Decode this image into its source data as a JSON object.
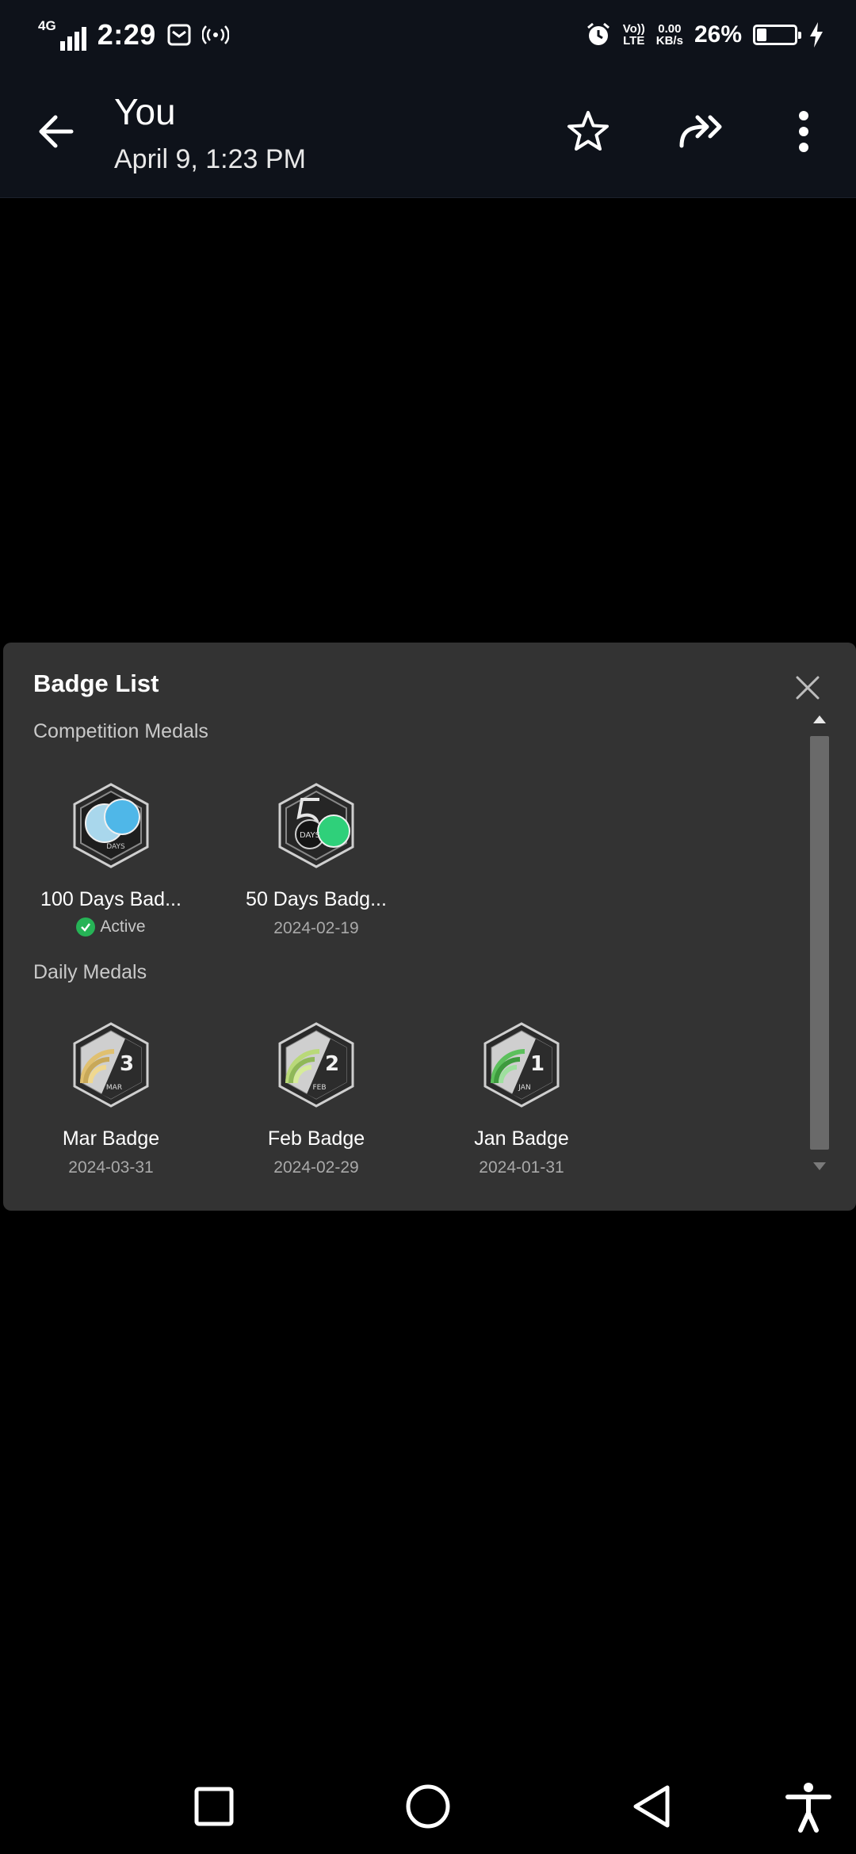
{
  "status_bar": {
    "network": "4G",
    "time": "2:29",
    "volte_line1": "Vo))",
    "volte_line2": "LTE",
    "speed_line1": "0.00",
    "speed_line2": "KB/s",
    "battery_percent": "26%",
    "battery_level": 0.26,
    "icons": [
      "signal-icon",
      "mail-icon",
      "hotspot-icon",
      "alarm-icon",
      "battery-icon",
      "charging-icon"
    ]
  },
  "app_bar": {
    "title": "You",
    "subtitle": "April 9, 1:23 PM",
    "icons": [
      "back-arrow-icon",
      "star-icon",
      "forward-icon",
      "more-vert-icon"
    ]
  },
  "badge_panel": {
    "title": "Badge List",
    "sections": [
      {
        "label": "Competition Medals",
        "badges": [
          {
            "name": "100 Days Bad...",
            "status": "Active",
            "icon_text": "DAYS",
            "icon": "100-days-badge-icon"
          },
          {
            "name": "50 Days Badg...",
            "date": "2024-02-19",
            "icon_text": "DAYS",
            "icon": "50-days-badge-icon"
          }
        ]
      },
      {
        "label": "Daily Medals",
        "badges": [
          {
            "name": "Mar Badge",
            "date": "2024-03-31",
            "number": "3",
            "month": "MAR",
            "color": "#e0c070",
            "icon": "mar-badge-icon"
          },
          {
            "name": "Feb Badge",
            "date": "2024-02-29",
            "number": "2",
            "month": "FEB",
            "color": "#b9d979",
            "icon": "feb-badge-icon"
          },
          {
            "name": "Jan Badge",
            "date": "2024-01-31",
            "number": "1",
            "month": "JAN",
            "color": "#5cc05c",
            "icon": "jan-badge-icon"
          }
        ]
      }
    ]
  },
  "nav_bar": {
    "icons": [
      "recents-square-icon",
      "home-circle-icon",
      "back-triangle-icon",
      "accessibility-icon"
    ]
  },
  "colors": {
    "top_bar": "#0e121a",
    "panel": "#333333",
    "active_green": "#26b356"
  }
}
